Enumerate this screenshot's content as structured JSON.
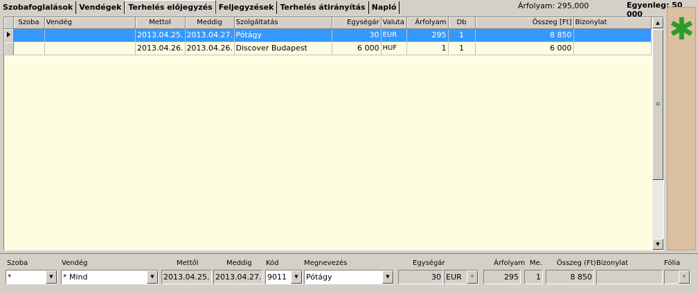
{
  "tabs": [
    {
      "label": "Szobafoglalások"
    },
    {
      "label": "Vendégek"
    },
    {
      "label": "Terhelés előjegyzés",
      "active": true
    },
    {
      "label": "Feljegyzések"
    },
    {
      "label": "Terhelés átirányítás"
    },
    {
      "label": "Napló"
    }
  ],
  "header": {
    "rate": "Árfolyam: 295,000",
    "balance": "Egyenleg: 50 000"
  },
  "grid": {
    "columns": [
      "Szoba",
      "Vendég",
      "Mettol",
      "Meddig",
      "Szolgáltatás",
      "Egységár",
      "Valuta",
      "Árfolyam",
      "Db",
      "Összeg [Ft]",
      "Bizonylat"
    ],
    "rows": [
      {
        "szoba": "",
        "vendeg": "",
        "mettol": "2013.04.25.",
        "meddig": "2013.04.27.",
        "szolgaltatas": "Pótágy",
        "egysegar": "30",
        "valuta": "EUR",
        "arfolyam": "295",
        "db": "1",
        "osszeg": "8 850",
        "bizonylat": "",
        "selected": true
      },
      {
        "szoba": "",
        "vendeg": "",
        "mettol": "2013.04.26.",
        "meddig": "2013.04.26.",
        "szolgaltatas": "Discover Budapest",
        "egysegar": "6 000",
        "valuta": "HUF",
        "arfolyam": "1",
        "db": "1",
        "osszeg": "6 000",
        "bizonylat": ""
      }
    ]
  },
  "form": {
    "labels": {
      "szoba": "Szoba",
      "vendeg": "Vendég",
      "mettol": "Mettől",
      "meddig": "Meddig",
      "kod": "Kód",
      "megnevezes": "Megnevezés",
      "egysegar": "Egységár",
      "arfolyam": "Árfolyam",
      "me": "Me.",
      "osszeg": "Összeg (Ft)",
      "bizonylat": "Bizonylat",
      "folia": "Fólia"
    },
    "values": {
      "szoba": "*",
      "vendeg": "* Mind",
      "mettol": "2013.04.25.",
      "meddig": "2013.04.27.",
      "kod": "9011",
      "megnevezes": "Pótágy",
      "egysegar": "30",
      "valuta": "EUR",
      "arfolyam": "295",
      "me": "1",
      "osszeg": "8 850",
      "bizonylat": "",
      "folia": ""
    }
  },
  "side": {
    "icon": "asterisk-icon",
    "star_color": "#2a9d2a"
  },
  "colors": {
    "selection": "#3399ff",
    "grid_background": "#fdfde1"
  }
}
